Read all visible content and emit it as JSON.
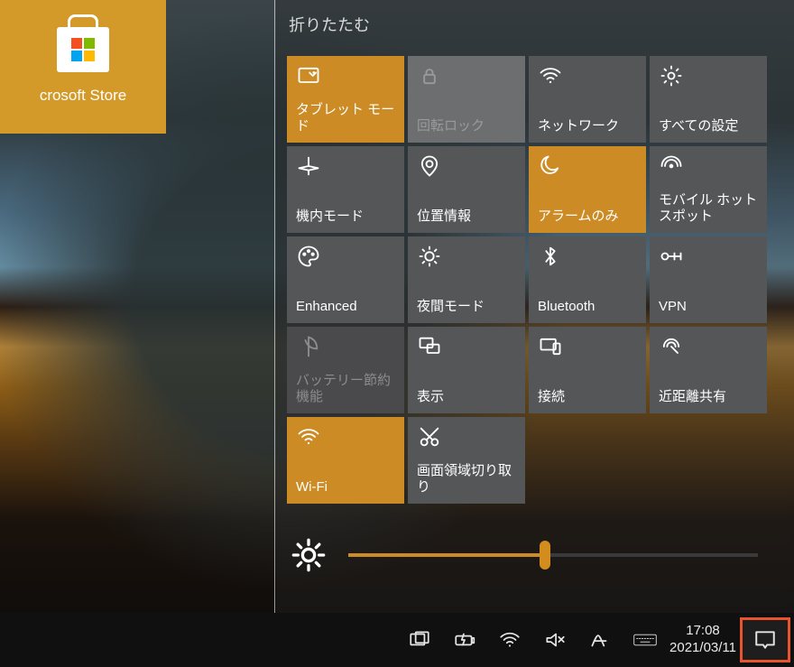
{
  "store_tile": {
    "label": "crosoft Store"
  },
  "action_center": {
    "collapse_label": "折りたたむ",
    "tiles": [
      {
        "label": "タブレット モード",
        "icon": "tablet-mode"
      },
      {
        "label": "回転ロック",
        "icon": "rotation-lock"
      },
      {
        "label": "ネットワーク",
        "icon": "network"
      },
      {
        "label": "すべての設定",
        "icon": "settings"
      },
      {
        "label": "機内モード",
        "icon": "airplane"
      },
      {
        "label": "位置情報",
        "icon": "location"
      },
      {
        "label": "アラームのみ",
        "icon": "moon"
      },
      {
        "label": "モバイル ホットスポット",
        "icon": "hotspot"
      },
      {
        "label": "Enhanced",
        "icon": "palette"
      },
      {
        "label": "夜間モード",
        "icon": "night-light"
      },
      {
        "label": "Bluetooth",
        "icon": "bluetooth"
      },
      {
        "label": "VPN",
        "icon": "vpn"
      },
      {
        "label": "バッテリー節約機能",
        "icon": "leaf"
      },
      {
        "label": "表示",
        "icon": "project"
      },
      {
        "label": "接続",
        "icon": "connect"
      },
      {
        "label": "近距離共有",
        "icon": "nearby"
      },
      {
        "label": "Wi-Fi",
        "icon": "wifi"
      },
      {
        "label": "画面領域切り取り",
        "icon": "snip"
      }
    ],
    "brightness_percent": 48
  },
  "taskbar": {
    "clock_time": "17:08",
    "clock_date": "2021/03/11"
  },
  "tile_states": {
    "active": [
      0,
      6,
      16
    ],
    "disabled": [
      1
    ],
    "muted": [
      12
    ]
  }
}
